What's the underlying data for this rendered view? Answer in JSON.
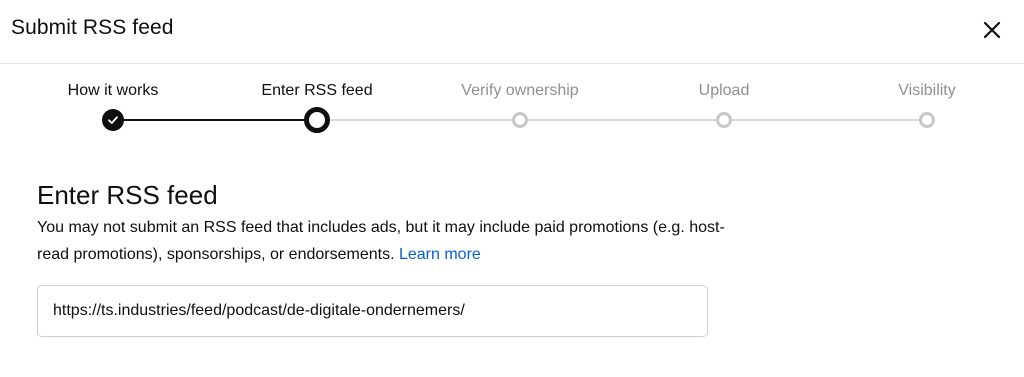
{
  "dialog": {
    "title": "Submit RSS feed",
    "close_icon": "close-icon"
  },
  "stepper": {
    "steps": [
      {
        "label": "How it works",
        "state": "done"
      },
      {
        "label": "Enter RSS feed",
        "state": "current"
      },
      {
        "label": "Verify ownership",
        "state": "pending"
      },
      {
        "label": "Upload",
        "state": "pending"
      },
      {
        "label": "Visibility",
        "state": "pending"
      }
    ]
  },
  "content": {
    "heading": "Enter RSS feed",
    "description": "You may not submit an RSS feed that includes ads, but it may include paid promotions (e.g. host-read promotions), sponsorships, or endorsements.",
    "learn_more": "Learn more",
    "feed_url": "https://ts.industries/feed/podcast/de-digitale-ondernemers/"
  },
  "colors": {
    "accent_link": "#065fd4",
    "active_step": "#0f0f0f",
    "pending_step": "#c7c7c7"
  }
}
